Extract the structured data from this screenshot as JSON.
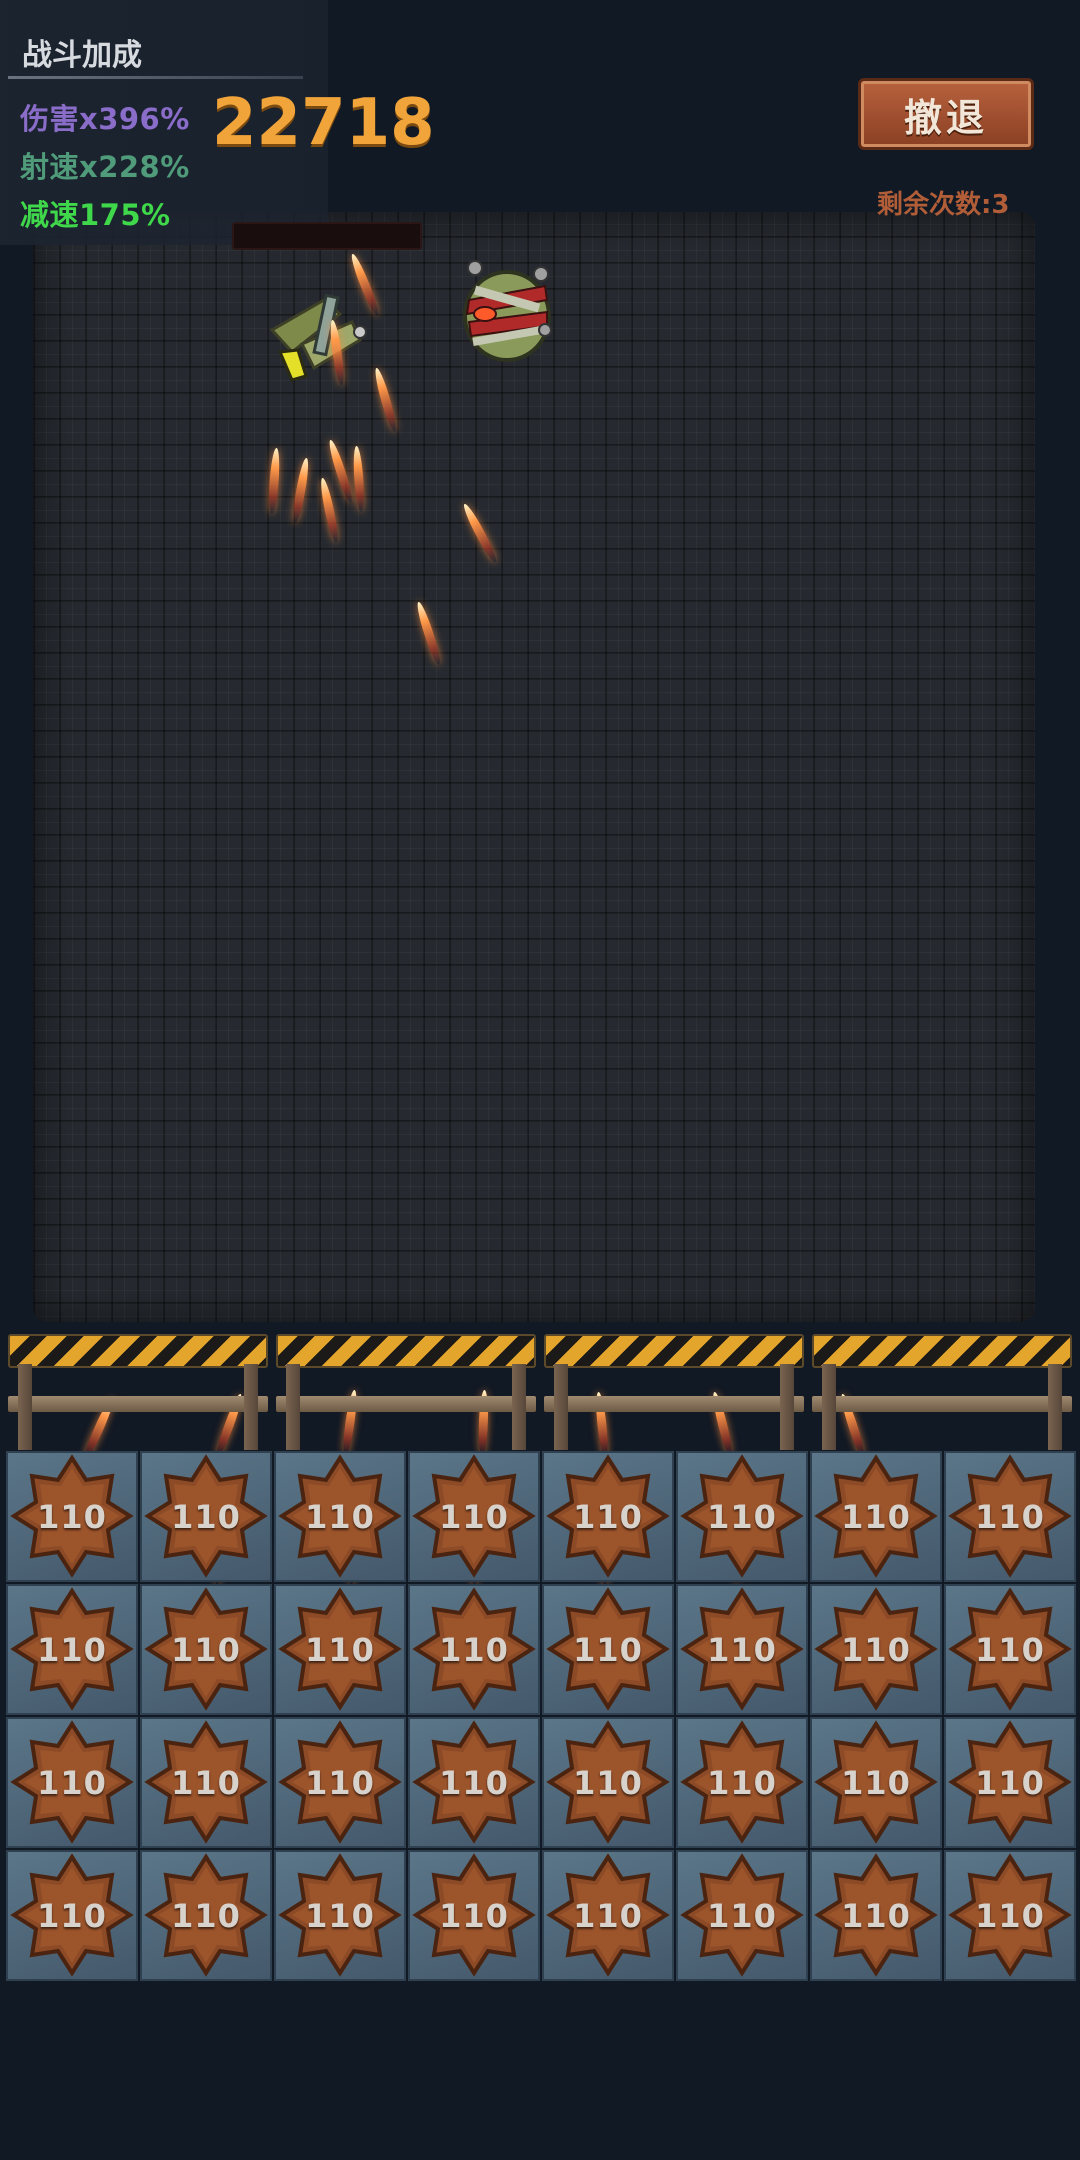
{
  "buff_panel": {
    "title": "战斗加成",
    "damage": "伤害x396%",
    "fire_rate": "射速x228%",
    "slow": "减速175%"
  },
  "score": "22718",
  "retreat": {
    "label": "撤退",
    "remaining": "剩余次数:3"
  },
  "colors": {
    "damage": "#8a6cc9",
    "fire_rate": "#4f9b7a",
    "slow": "#3fd84a",
    "score": "#f0a43a",
    "button": "#a5522f"
  },
  "grid": {
    "rows": [
      [
        "110",
        "110",
        "110",
        "110",
        "110",
        "110",
        "110",
        "110"
      ],
      [
        "110",
        "110",
        "110",
        "110",
        "110",
        "110",
        "110",
        "110"
      ],
      [
        "110",
        "110",
        "110",
        "110",
        "110",
        "110",
        "110",
        "110"
      ],
      [
        "110",
        "110",
        "110",
        "110",
        "110",
        "110",
        "110",
        "110"
      ]
    ]
  }
}
